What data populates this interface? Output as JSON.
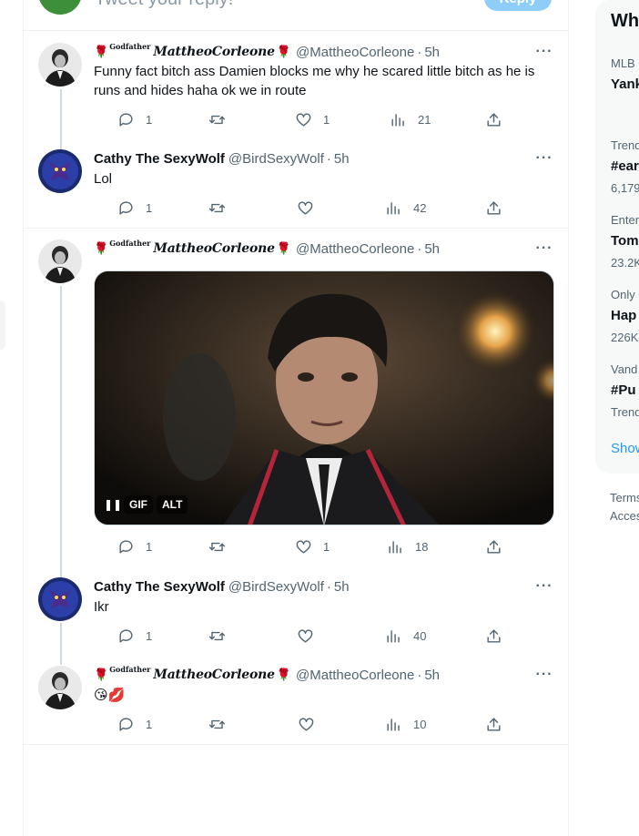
{
  "reply_box": {
    "placeholder": "Tweet your reply!",
    "button_label": "Reply"
  },
  "tweets": [
    {
      "prefix": "Godfather",
      "name": "MattheoCorleone",
      "handle": "@MattheoCorleone",
      "time": "5h",
      "text": "Funny fact bitch ass Damien blocks me why he scared little bitch as he is runs and hides haha ok we in route",
      "replies": "1",
      "retweets": "",
      "likes": "1",
      "views": "21"
    },
    {
      "name": "Cathy The SexyWolf",
      "handle": "@BirdSexyWolf",
      "time": "5h",
      "text": "Lol",
      "replies": "1",
      "retweets": "",
      "likes": "",
      "views": "42"
    },
    {
      "prefix": "Godfather",
      "name": "MattheoCorleone",
      "handle": "@MattheoCorleone",
      "time": "5h",
      "text": "",
      "media": {
        "gif_label": "GIF",
        "alt_label": "ALT",
        "pause_icon": "pause-icon"
      },
      "replies": "1",
      "retweets": "",
      "likes": "1",
      "views": "18"
    },
    {
      "name": "Cathy The SexyWolf",
      "handle": "@BirdSexyWolf",
      "time": "5h",
      "text": "Ikr",
      "replies": "1",
      "retweets": "",
      "likes": "",
      "views": "40"
    },
    {
      "prefix": "Godfather",
      "name": "MattheoCorleone",
      "handle": "@MattheoCorleone",
      "time": "5h",
      "text": "😘💋",
      "replies": "1",
      "retweets": "",
      "likes": "",
      "views": "10"
    }
  ],
  "sidebar": {
    "title": "Wh",
    "trends": [
      {
        "context": "MLB",
        "name": "Yank",
        "count": ""
      },
      {
        "context": "Trend",
        "name": "#ear",
        "count": "6,179"
      },
      {
        "context": "Enter",
        "name": "Tom",
        "count": "23.2K"
      },
      {
        "context": "Only",
        "name": "Hap",
        "count": "226K"
      },
      {
        "context": "Vand",
        "name": "#Pu",
        "count": "Trend"
      }
    ],
    "show_more": "Show",
    "footer": [
      "Terms",
      "Acces"
    ]
  },
  "colors": {
    "accent": "#1d9bf0",
    "muted": "#536471",
    "border": "#eff3f4",
    "rose": "#b01818"
  }
}
